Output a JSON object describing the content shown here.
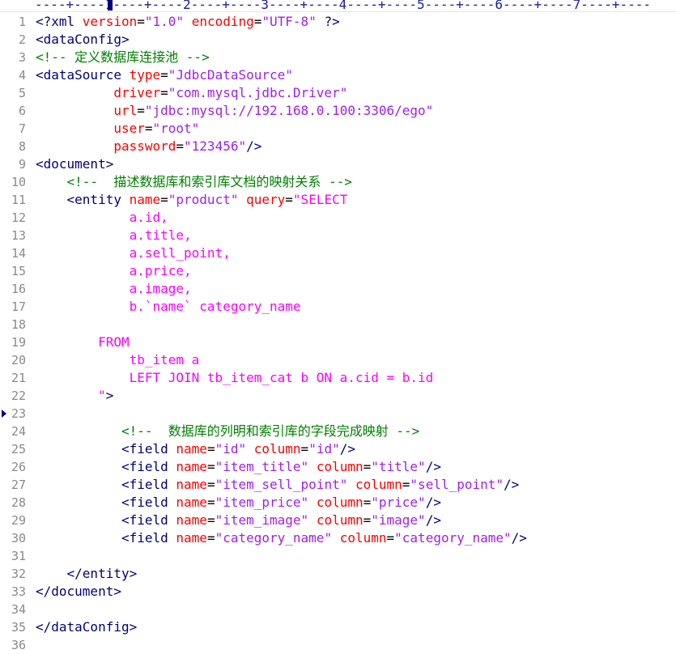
{
  "ruler": {
    "text": "----+----1----+----2----+----3----+----4----+----5----+----6----+----7----+----"
  },
  "current_line_marker": "23",
  "lines": [
    {
      "n": "1",
      "tokens": [
        [
          "tag",
          "<?xml "
        ],
        [
          "attr",
          "version"
        ],
        [
          "plain",
          "="
        ],
        [
          "val",
          "\"1.0\""
        ],
        [
          "plain",
          " "
        ],
        [
          "attr",
          "encoding"
        ],
        [
          "plain",
          "="
        ],
        [
          "val",
          "\"UTF-8\""
        ],
        [
          "tag",
          " ?>"
        ]
      ]
    },
    {
      "n": "2",
      "tokens": [
        [
          "tag",
          "<dataConfig>"
        ]
      ]
    },
    {
      "n": "3",
      "tokens": [
        [
          "comment",
          "<!-- 定义数据库连接池 -->"
        ]
      ]
    },
    {
      "n": "4",
      "tokens": [
        [
          "tag",
          "<dataSource "
        ],
        [
          "attr",
          "type"
        ],
        [
          "plain",
          "="
        ],
        [
          "val",
          "\"JdbcDataSource\""
        ]
      ]
    },
    {
      "n": "5",
      "tokens": [
        [
          "plain",
          "          "
        ],
        [
          "attr",
          "driver"
        ],
        [
          "plain",
          "="
        ],
        [
          "val",
          "\"com.mysql.jdbc.Driver\""
        ]
      ]
    },
    {
      "n": "6",
      "tokens": [
        [
          "plain",
          "          "
        ],
        [
          "attr",
          "url"
        ],
        [
          "plain",
          "="
        ],
        [
          "val",
          "\"jdbc:mysql://192.168.0.100:3306/ego\""
        ]
      ]
    },
    {
      "n": "7",
      "tokens": [
        [
          "plain",
          "          "
        ],
        [
          "attr",
          "user"
        ],
        [
          "plain",
          "="
        ],
        [
          "val",
          "\"root\""
        ]
      ]
    },
    {
      "n": "8",
      "tokens": [
        [
          "plain",
          "          "
        ],
        [
          "attr",
          "password"
        ],
        [
          "plain",
          "="
        ],
        [
          "val",
          "\"123456\""
        ],
        [
          "tag",
          "/>"
        ]
      ]
    },
    {
      "n": "9",
      "tokens": [
        [
          "tag",
          "<document>"
        ]
      ]
    },
    {
      "n": "10",
      "tokens": [
        [
          "plain",
          "    "
        ],
        [
          "comment",
          "<!--  描述数据库和索引库文档的映射关系 -->"
        ]
      ]
    },
    {
      "n": "11",
      "tokens": [
        [
          "plain",
          "    "
        ],
        [
          "tag",
          "<entity "
        ],
        [
          "attr",
          "name"
        ],
        [
          "plain",
          "="
        ],
        [
          "val",
          "\"product\""
        ],
        [
          "plain",
          " "
        ],
        [
          "attr",
          "query"
        ],
        [
          "plain",
          "="
        ],
        [
          "txt",
          "\"SELECT"
        ]
      ]
    },
    {
      "n": "12",
      "tokens": [
        [
          "plain",
          "            "
        ],
        [
          "txt",
          "a.id,"
        ]
      ]
    },
    {
      "n": "13",
      "tokens": [
        [
          "plain",
          "            "
        ],
        [
          "txt",
          "a.title,"
        ]
      ]
    },
    {
      "n": "14",
      "tokens": [
        [
          "plain",
          "            "
        ],
        [
          "txt",
          "a.sell_point,"
        ]
      ]
    },
    {
      "n": "15",
      "tokens": [
        [
          "plain",
          "            "
        ],
        [
          "txt",
          "a.price,"
        ]
      ]
    },
    {
      "n": "16",
      "tokens": [
        [
          "plain",
          "            "
        ],
        [
          "txt",
          "a.image,"
        ]
      ]
    },
    {
      "n": "17",
      "tokens": [
        [
          "plain",
          "            "
        ],
        [
          "txt",
          "b.`name` category_name"
        ]
      ]
    },
    {
      "n": "18",
      "tokens": []
    },
    {
      "n": "19",
      "tokens": [
        [
          "plain",
          "        "
        ],
        [
          "txt",
          "FROM"
        ]
      ]
    },
    {
      "n": "20",
      "tokens": [
        [
          "plain",
          "            "
        ],
        [
          "txt",
          "tb_item a"
        ]
      ]
    },
    {
      "n": "21",
      "tokens": [
        [
          "plain",
          "            "
        ],
        [
          "txt",
          "LEFT JOIN tb_item_cat b ON a.cid = b.id"
        ]
      ]
    },
    {
      "n": "22",
      "tokens": [
        [
          "plain",
          "        "
        ],
        [
          "txt",
          "\""
        ],
        [
          "tag",
          ">"
        ]
      ]
    },
    {
      "n": "23",
      "tokens": []
    },
    {
      "n": "24",
      "tokens": [
        [
          "plain",
          "           "
        ],
        [
          "comment",
          "<!--  数据库的列明和索引库的字段完成映射 -->"
        ]
      ]
    },
    {
      "n": "25",
      "tokens": [
        [
          "plain",
          "           "
        ],
        [
          "tag",
          "<field "
        ],
        [
          "attr",
          "name"
        ],
        [
          "plain",
          "="
        ],
        [
          "val",
          "\"id\""
        ],
        [
          "plain",
          " "
        ],
        [
          "attr",
          "column"
        ],
        [
          "plain",
          "="
        ],
        [
          "val",
          "\"id\""
        ],
        [
          "tag",
          "/>"
        ]
      ]
    },
    {
      "n": "26",
      "tokens": [
        [
          "plain",
          "           "
        ],
        [
          "tag",
          "<field "
        ],
        [
          "attr",
          "name"
        ],
        [
          "plain",
          "="
        ],
        [
          "val",
          "\"item_title\""
        ],
        [
          "plain",
          " "
        ],
        [
          "attr",
          "column"
        ],
        [
          "plain",
          "="
        ],
        [
          "val",
          "\"title\""
        ],
        [
          "tag",
          "/>"
        ]
      ]
    },
    {
      "n": "27",
      "tokens": [
        [
          "plain",
          "           "
        ],
        [
          "tag",
          "<field "
        ],
        [
          "attr",
          "name"
        ],
        [
          "plain",
          "="
        ],
        [
          "val",
          "\"item_sell_point\""
        ],
        [
          "plain",
          " "
        ],
        [
          "attr",
          "column"
        ],
        [
          "plain",
          "="
        ],
        [
          "val",
          "\"sell_point\""
        ],
        [
          "tag",
          "/>"
        ]
      ]
    },
    {
      "n": "28",
      "tokens": [
        [
          "plain",
          "           "
        ],
        [
          "tag",
          "<field "
        ],
        [
          "attr",
          "name"
        ],
        [
          "plain",
          "="
        ],
        [
          "val",
          "\"item_price\""
        ],
        [
          "plain",
          " "
        ],
        [
          "attr",
          "column"
        ],
        [
          "plain",
          "="
        ],
        [
          "val",
          "\"price\""
        ],
        [
          "tag",
          "/>"
        ]
      ]
    },
    {
      "n": "29",
      "tokens": [
        [
          "plain",
          "           "
        ],
        [
          "tag",
          "<field "
        ],
        [
          "attr",
          "name"
        ],
        [
          "plain",
          "="
        ],
        [
          "val",
          "\"item_image\""
        ],
        [
          "plain",
          " "
        ],
        [
          "attr",
          "column"
        ],
        [
          "plain",
          "="
        ],
        [
          "val",
          "\"image\""
        ],
        [
          "tag",
          "/>"
        ]
      ]
    },
    {
      "n": "30",
      "tokens": [
        [
          "plain",
          "           "
        ],
        [
          "tag",
          "<field "
        ],
        [
          "attr",
          "name"
        ],
        [
          "plain",
          "="
        ],
        [
          "val",
          "\"category_name\""
        ],
        [
          "plain",
          " "
        ],
        [
          "attr",
          "column"
        ],
        [
          "plain",
          "="
        ],
        [
          "val",
          "\"category_name\""
        ],
        [
          "tag",
          "/>"
        ]
      ]
    },
    {
      "n": "31",
      "tokens": []
    },
    {
      "n": "32",
      "tokens": [
        [
          "plain",
          "    "
        ],
        [
          "tag",
          "</entity>"
        ]
      ]
    },
    {
      "n": "33",
      "tokens": [
        [
          "tag",
          "</document>"
        ]
      ]
    },
    {
      "n": "34",
      "tokens": []
    },
    {
      "n": "35",
      "tokens": [
        [
          "tag",
          "</dataConfig>"
        ]
      ]
    },
    {
      "n": "36",
      "tokens": []
    }
  ]
}
